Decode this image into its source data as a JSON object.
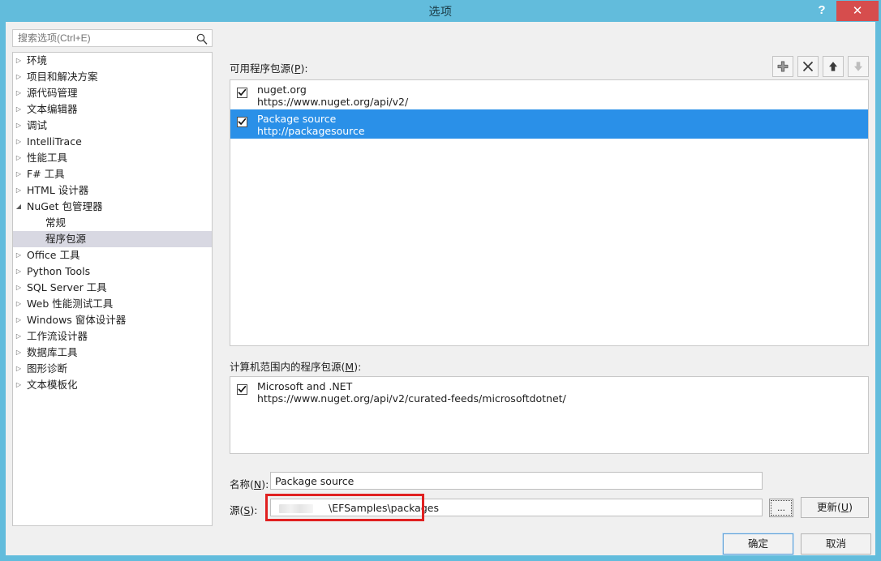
{
  "window": {
    "title": "选项",
    "help_label": "?",
    "close_label": "✕"
  },
  "search": {
    "placeholder": "搜索选项(Ctrl+E)",
    "value": "",
    "icon": "search-icon"
  },
  "tree": {
    "items": [
      {
        "label": "环境",
        "depth": 0,
        "arrow": "▷",
        "selected": false
      },
      {
        "label": "项目和解决方案",
        "depth": 0,
        "arrow": "▷",
        "selected": false
      },
      {
        "label": "源代码管理",
        "depth": 0,
        "arrow": "▷",
        "selected": false
      },
      {
        "label": "文本编辑器",
        "depth": 0,
        "arrow": "▷",
        "selected": false
      },
      {
        "label": "调试",
        "depth": 0,
        "arrow": "▷",
        "selected": false
      },
      {
        "label": "IntelliTrace",
        "depth": 0,
        "arrow": "▷",
        "selected": false
      },
      {
        "label": "性能工具",
        "depth": 0,
        "arrow": "▷",
        "selected": false
      },
      {
        "label": "F# 工具",
        "depth": 0,
        "arrow": "▷",
        "selected": false
      },
      {
        "label": "HTML 设计器",
        "depth": 0,
        "arrow": "▷",
        "selected": false
      },
      {
        "label": "NuGet 包管理器",
        "depth": 0,
        "arrow": "◢",
        "selected": false
      },
      {
        "label": "常规",
        "depth": 1,
        "arrow": "",
        "selected": false
      },
      {
        "label": "程序包源",
        "depth": 1,
        "arrow": "",
        "selected": true
      },
      {
        "label": "Office 工具",
        "depth": 0,
        "arrow": "▷",
        "selected": false
      },
      {
        "label": "Python Tools",
        "depth": 0,
        "arrow": "▷",
        "selected": false
      },
      {
        "label": "SQL Server 工具",
        "depth": 0,
        "arrow": "▷",
        "selected": false
      },
      {
        "label": "Web 性能测试工具",
        "depth": 0,
        "arrow": "▷",
        "selected": false
      },
      {
        "label": "Windows 窗体设计器",
        "depth": 0,
        "arrow": "▷",
        "selected": false
      },
      {
        "label": "工作流设计器",
        "depth": 0,
        "arrow": "▷",
        "selected": false
      },
      {
        "label": "数据库工具",
        "depth": 0,
        "arrow": "▷",
        "selected": false
      },
      {
        "label": "图形诊断",
        "depth": 0,
        "arrow": "▷",
        "selected": false
      },
      {
        "label": "文本模板化",
        "depth": 0,
        "arrow": "▷",
        "selected": false
      }
    ]
  },
  "main": {
    "available_label_pre": "可用程序包源(",
    "available_accel": "P",
    "available_label_post": "):",
    "machine_label_pre": "计算机范围内的程序包源(",
    "machine_accel": "M",
    "machine_label_post": "):",
    "toolbar": {
      "add": "add-source-button",
      "remove": "remove-source-button",
      "move_up": "move-up-button",
      "move_down": "move-down-button"
    },
    "available_sources": [
      {
        "name": "nuget.org",
        "url": "https://www.nuget.org/api/v2/",
        "checked": true,
        "selected": false
      },
      {
        "name": "Package source",
        "url": "http://packagesource",
        "checked": true,
        "selected": true
      }
    ],
    "machine_sources": [
      {
        "name": "Microsoft and .NET",
        "url": "https://www.nuget.org/api/v2/curated-feeds/microsoftdotnet/",
        "checked": true,
        "selected": false
      }
    ],
    "name_label_pre": "名称(",
    "name_accel": "N",
    "name_label_post": "):",
    "name_value": "Package source",
    "source_label_pre": "源(",
    "source_accel": "S",
    "source_label_post": "):",
    "source_value": "\\EFSamples\\packages",
    "browse_label": "...",
    "update_label_pre": "更新(",
    "update_accel": "U",
    "update_label_post": ")"
  },
  "footer": {
    "ok_label": "确定",
    "cancel_label": "取消"
  },
  "colors": {
    "title_bar": "#62bcdc",
    "close_button": "#d64d4d",
    "selection_blue": "#2a90e8",
    "tree_selection": "#d8d8e2",
    "annotation_red": "#e02020",
    "client_bg": "#f0f0f0"
  }
}
